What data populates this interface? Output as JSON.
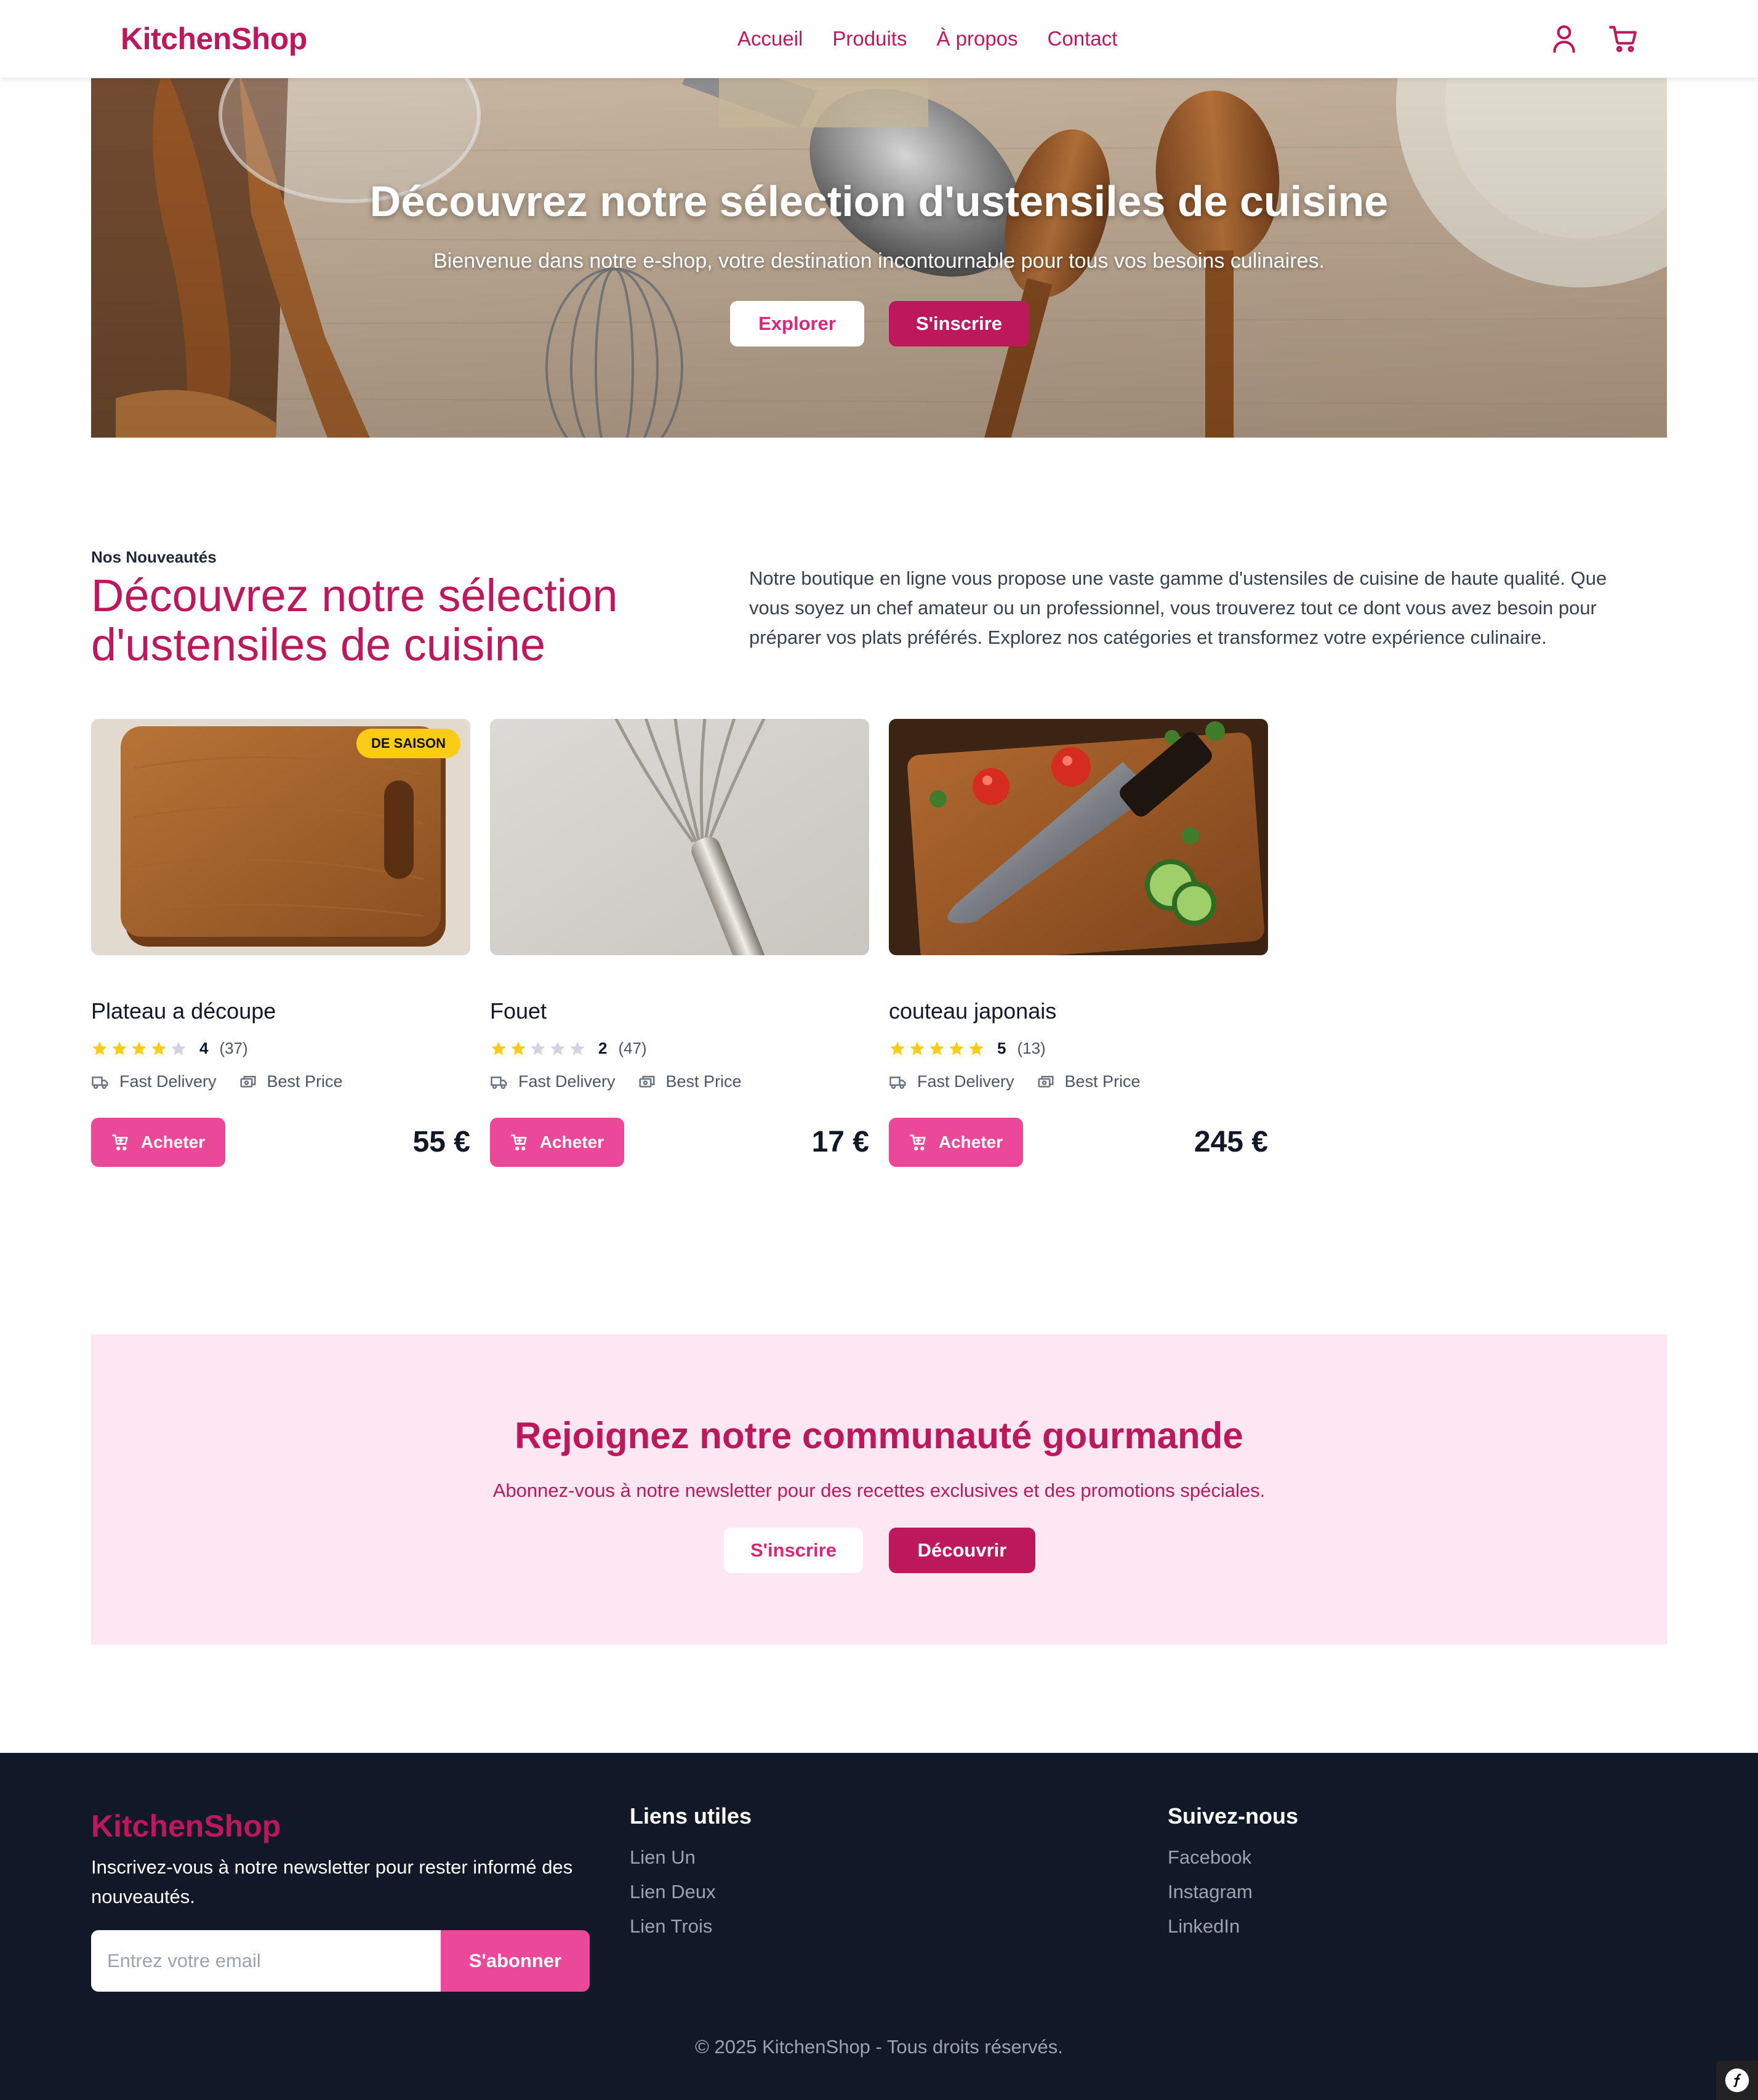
{
  "nav": {
    "logo": "KitchenShop",
    "links": [
      "Accueil",
      "Produits",
      "À propos",
      "Contact"
    ],
    "icons": [
      "user-icon",
      "cart-icon"
    ]
  },
  "hero": {
    "title": "Découvrez notre sélection d'ustensiles de cuisine",
    "subtitle": "Bienvenue dans notre e-shop, votre destination incontournable pour tous vos besoins culinaires.",
    "explore_label": "Explorer",
    "signup_label": "S'inscrire"
  },
  "intro": {
    "eyebrow": "Nos Nouveautés",
    "title": "Découvrez notre sélection d'ustensiles de cuisine",
    "description": "Notre boutique en ligne vous propose une vaste gamme d'ustensiles de cuisine de haute qualité. Que vous soyez un chef amateur ou un professionnel, vous trouverez tout ce dont vous avez besoin pour préparer vos plats préférés. Explorez nos catégories et transformez votre expérience culinaire."
  },
  "products": [
    {
      "name": "Plateau a découpe",
      "rating": 4,
      "rating_label": "4",
      "reviews": "(37)",
      "badge": "DE SAISON",
      "feature_1": "Fast Delivery",
      "feature_2": "Best Price",
      "buy_label": "Acheter",
      "price": "55 €"
    },
    {
      "name": "Fouet",
      "rating": 2,
      "rating_label": "2",
      "reviews": "(47)",
      "badge": "",
      "feature_1": "Fast Delivery",
      "feature_2": "Best Price",
      "buy_label": "Acheter",
      "price": "17 €"
    },
    {
      "name": "couteau japonais",
      "rating": 5,
      "rating_label": "5",
      "reviews": "(13)",
      "badge": "",
      "feature_1": "Fast Delivery",
      "feature_2": "Best Price",
      "buy_label": "Acheter",
      "price": "245 €"
    }
  ],
  "community": {
    "title": "Rejoignez notre communauté gourmande",
    "subtitle": "Abonnez-vous à notre newsletter pour des recettes exclusives et des promotions spéciales.",
    "signup_label": "S'inscrire",
    "discover_label": "Découvrir"
  },
  "footer": {
    "logo": "KitchenShop",
    "text": "Inscrivez-vous à notre newsletter pour rester informé des nouveautés.",
    "email_placeholder": "Entrez votre email",
    "subscribe_label": "S'abonner",
    "useful_title": "Liens utiles",
    "useful_links": [
      "Lien Un",
      "Lien Deux",
      "Lien Trois"
    ],
    "follow_title": "Suivez-nous",
    "follow_links": [
      "Facebook",
      "Instagram",
      "LinkedIn"
    ],
    "copyright": "© 2025 KitchenShop - Tous droits réservés."
  },
  "colors": {
    "brand": "#be185d",
    "accent": "#ec4899",
    "band_bg": "#fce7f3",
    "footer_bg": "#111827",
    "star": "#facc15",
    "star_empty": "#d1d5db"
  }
}
